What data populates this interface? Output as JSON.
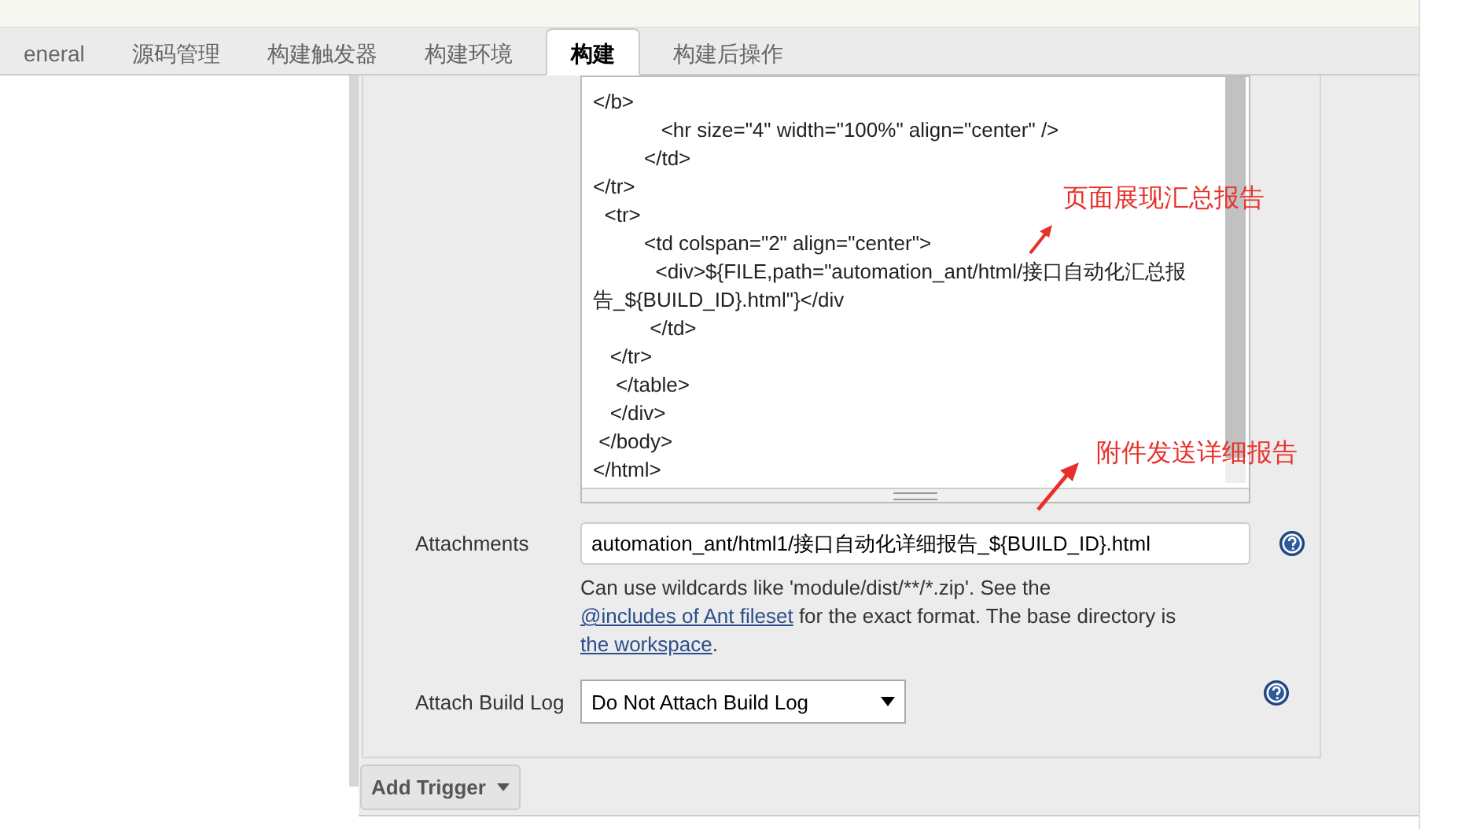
{
  "tabs": [
    {
      "label": "eneral",
      "selected": false
    },
    {
      "label": "源码管理",
      "selected": false
    },
    {
      "label": "构建触发器",
      "selected": false
    },
    {
      "label": "构建环境",
      "selected": false
    },
    {
      "label": "构建",
      "selected": true
    },
    {
      "label": "构建后操作",
      "selected": false
    }
  ],
  "editor": {
    "lines": [
      "</b>",
      "            <hr size=\"4\" width=\"100%\" align=\"center\" />",
      "         </td>",
      "</tr>",
      "  <tr>",
      "         <td colspan=\"2\" align=\"center\">",
      "           <div>${FILE,path=\"automation_ant/html/接口自动化汇总报告_${BUILD_ID}.html\"}</div",
      "          </td>",
      "   </tr>",
      "    </table>",
      "   </div>",
      " </body>",
      "</html>"
    ]
  },
  "annotations": [
    {
      "text": "页面展现汇总报告"
    },
    {
      "text": "附件发送详细报告"
    }
  ],
  "attachments": {
    "label": "Attachments",
    "value": "automation_ant/html1/接口自动化详细报告_${BUILD_ID}.html"
  },
  "help_text": [
    {
      "kind": "text",
      "text": "Can use wildcards like 'module/dist/**/*.zip'. See the "
    },
    {
      "kind": "link",
      "text": "@includes of Ant fileset"
    },
    {
      "kind": "text",
      "text": " for the exact format. The base directory is "
    },
    {
      "kind": "link",
      "text": "the workspace"
    },
    {
      "kind": "text",
      "text": "."
    }
  ],
  "attach_build_log": {
    "label": "Attach Build Log",
    "value": "Do Not Attach Build Log"
  },
  "add_trigger": {
    "label": "Add Trigger"
  }
}
